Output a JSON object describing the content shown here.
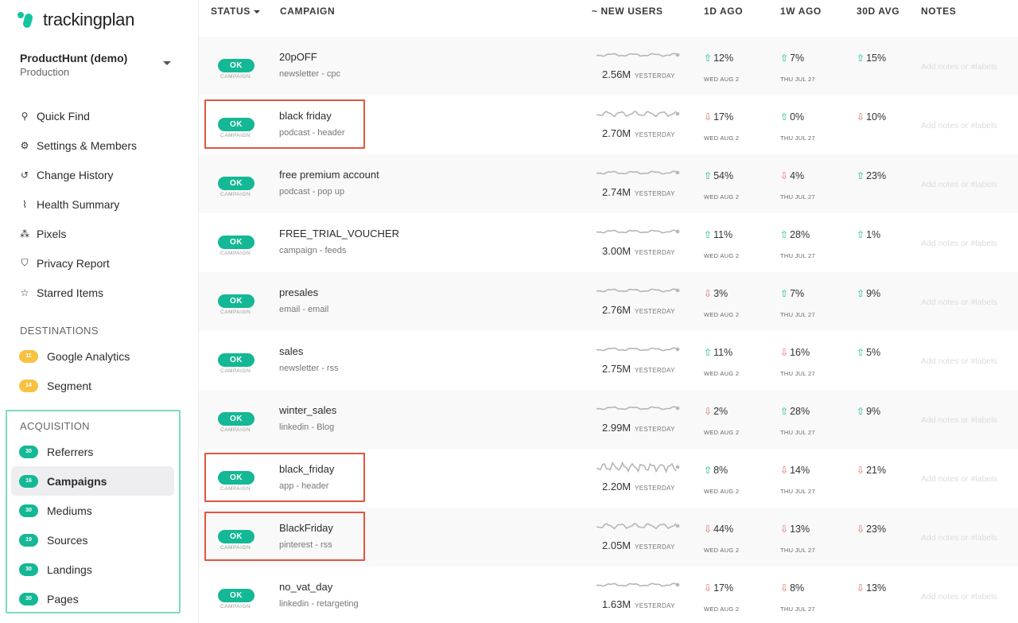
{
  "brand": {
    "name": "trackingplan"
  },
  "workspace": {
    "name": "ProductHunt (demo)",
    "environment": "Production"
  },
  "nav": [
    {
      "label": "Quick Find",
      "icon": "search-icon",
      "glyph": "⚲"
    },
    {
      "label": "Settings & Members",
      "icon": "gear-icon",
      "glyph": "⚙"
    },
    {
      "label": "Change History",
      "icon": "history-icon",
      "glyph": "↺"
    },
    {
      "label": "Health Summary",
      "icon": "pulse-icon",
      "glyph": "⌇"
    },
    {
      "label": "Pixels",
      "icon": "pixels-icon",
      "glyph": "⁂"
    },
    {
      "label": "Privacy Report",
      "icon": "shield-icon",
      "glyph": "⛉"
    },
    {
      "label": "Starred Items",
      "icon": "star-icon",
      "glyph": "☆"
    }
  ],
  "destinations": {
    "title": "DESTINATIONS",
    "items": [
      {
        "label": "Google Analytics",
        "count": "11"
      },
      {
        "label": "Segment",
        "count": "14"
      }
    ]
  },
  "acquisition": {
    "title": "ACQUISITION",
    "items": [
      {
        "label": "Referrers",
        "count": "30"
      },
      {
        "label": "Campaigns",
        "count": "16",
        "active": true
      },
      {
        "label": "Mediums",
        "count": "30"
      },
      {
        "label": "Sources",
        "count": "19"
      },
      {
        "label": "Landings",
        "count": "30"
      },
      {
        "label": "Pages",
        "count": "30"
      }
    ]
  },
  "table": {
    "headers": {
      "status": "STATUS",
      "campaign": "CAMPAIGN",
      "new_users": "~ NEW USERS",
      "d1": "1D AGO",
      "w1": "1W AGO",
      "d30": "30D AVG",
      "notes": "NOTES"
    },
    "status_label": "OK",
    "status_sub": "CAMPAIGN",
    "yesterday": "YESTERDAY",
    "d1_date": "WED AUG 2",
    "w1_date": "THU JUL 27",
    "notes_placeholder": "Add notes or #labels",
    "rows": [
      {
        "name": "20pOFF",
        "sub": "newsletter - cpc",
        "users": "2.56M",
        "d1": "12%",
        "d1_dir": "up",
        "w1": "7%",
        "w1_dir": "up",
        "d30": "15%",
        "d30_dir": "up",
        "highlight": false,
        "spark": "smooth"
      },
      {
        "name": "black friday",
        "sub": "podcast - header",
        "users": "2.70M",
        "d1": "17%",
        "d1_dir": "down",
        "w1": "0%",
        "w1_dir": "up",
        "d30": "10%",
        "d30_dir": "down",
        "highlight": true,
        "spark": "wavy"
      },
      {
        "name": "free premium account",
        "sub": "podcast - pop up",
        "users": "2.74M",
        "d1": "54%",
        "d1_dir": "up",
        "w1": "4%",
        "w1_dir": "down",
        "d30": "23%",
        "d30_dir": "up",
        "highlight": false,
        "spark": "smooth"
      },
      {
        "name": "FREE_TRIAL_VOUCHER",
        "sub": "campaign - feeds",
        "users": "3.00M",
        "d1": "11%",
        "d1_dir": "up",
        "w1": "28%",
        "w1_dir": "up",
        "d30": "1%",
        "d30_dir": "up",
        "highlight": false,
        "spark": "smooth"
      },
      {
        "name": "presales",
        "sub": "email - email",
        "users": "2.76M",
        "d1": "3%",
        "d1_dir": "down",
        "w1": "7%",
        "w1_dir": "up",
        "d30": "9%",
        "d30_dir": "up",
        "highlight": false,
        "spark": "smooth"
      },
      {
        "name": "sales",
        "sub": "newsletter - rss",
        "users": "2.75M",
        "d1": "11%",
        "d1_dir": "up",
        "w1": "16%",
        "w1_dir": "down",
        "d30": "5%",
        "d30_dir": "up",
        "highlight": false,
        "spark": "smooth"
      },
      {
        "name": "winter_sales",
        "sub": "linkedin - Blog",
        "users": "2.99M",
        "d1": "2%",
        "d1_dir": "down",
        "w1": "28%",
        "w1_dir": "up",
        "d30": "9%",
        "d30_dir": "up",
        "highlight": false,
        "spark": "smooth"
      },
      {
        "name": "black_friday",
        "sub": "app - header",
        "users": "2.20M",
        "d1": "8%",
        "d1_dir": "up",
        "w1": "14%",
        "w1_dir": "down",
        "d30": "21%",
        "d30_dir": "down",
        "highlight": true,
        "spark": "noisy"
      },
      {
        "name": "BlackFriday",
        "sub": "pinterest - rss",
        "users": "2.05M",
        "d1": "44%",
        "d1_dir": "down",
        "w1": "13%",
        "w1_dir": "down",
        "d30": "23%",
        "d30_dir": "down",
        "highlight": true,
        "spark": "wavy"
      },
      {
        "name": "no_vat_day",
        "sub": "linkedin - retargeting",
        "users": "1.63M",
        "d1": "17%",
        "d1_dir": "down",
        "w1": "8%",
        "w1_dir": "down",
        "d30": "13%",
        "d30_dir": "down",
        "highlight": false,
        "spark": "smooth"
      }
    ]
  },
  "colors": {
    "accent": "#14b894",
    "up": "#14b894",
    "down": "#e06b60",
    "highlight": "#e0563e",
    "acquisition_box": "#7ddbbd"
  }
}
